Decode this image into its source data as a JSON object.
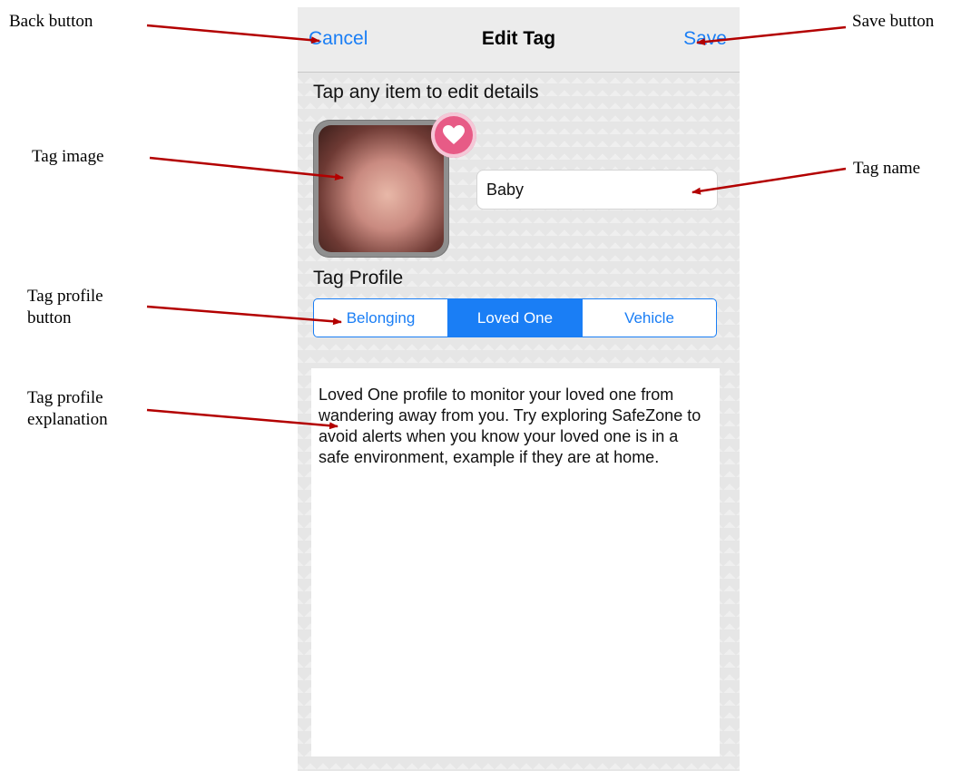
{
  "annotations": {
    "back": "Back button",
    "save": "Save button",
    "tag_image": "Tag image",
    "tag_name": "Tag name",
    "tag_profile_button_line1": "Tag profile",
    "tag_profile_button_line2": "button",
    "tag_profile_explanation_line1": "Tag profile",
    "tag_profile_explanation_line2": "explanation"
  },
  "navbar": {
    "cancel_label": "Cancel",
    "title": "Edit Tag",
    "save_label": "Save"
  },
  "hint": "Tap any item to edit details",
  "tag": {
    "name": "Baby"
  },
  "profile": {
    "label": "Tag Profile",
    "options": [
      "Belonging",
      "Loved One",
      "Vehicle"
    ],
    "selected": "Loved One",
    "explanation": "Loved One profile to monitor your loved one from wandering away from you. Try exploring SafeZone to avoid alerts when you know your loved one is in a safe environment, example if they are at home."
  },
  "colors": {
    "accent": "#1a7ef5",
    "heart_badge": "#e75b86",
    "arrow": "#b30000"
  },
  "icons": [
    "heart-icon"
  ]
}
